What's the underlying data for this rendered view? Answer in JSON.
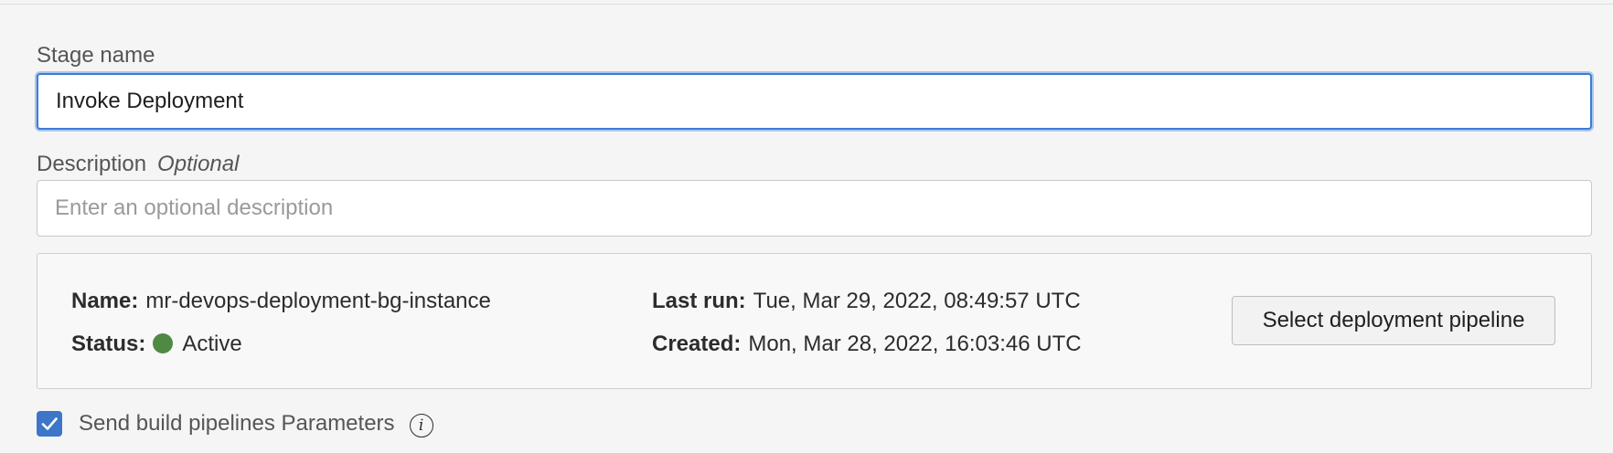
{
  "stage_name": {
    "label": "Stage name",
    "value": "Invoke Deployment"
  },
  "description": {
    "label": "Description",
    "optional_tag": "Optional",
    "placeholder": "Enter an optional description",
    "value": ""
  },
  "pipeline": {
    "name_key": "Name:",
    "name_value": "mr-devops-deployment-bg-instance",
    "status_key": "Status:",
    "status_value": "Active",
    "status_color": "#4e8a44",
    "last_run_key": "Last run:",
    "last_run_value": "Tue, Mar 29, 2022, 08:49:57 UTC",
    "created_key": "Created:",
    "created_value": "Mon, Mar 28, 2022, 16:03:46 UTC",
    "select_button_label": "Select deployment pipeline"
  },
  "send_params": {
    "checked": true,
    "label": "Send build pipelines Parameters",
    "info_icon": "info-icon"
  },
  "colors": {
    "focus_border": "#3f7cd0",
    "checkbox_fill": "#3d76c8"
  }
}
